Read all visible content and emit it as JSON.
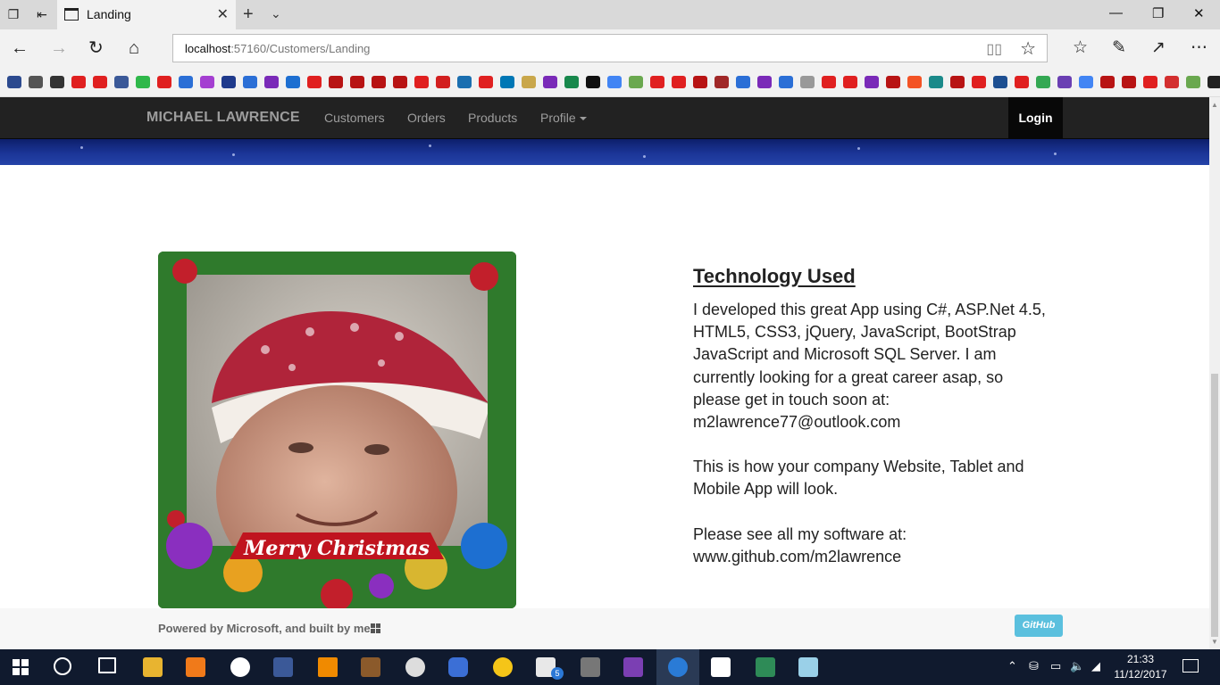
{
  "browser": {
    "tab_title": "Landing",
    "url_host": "localhost",
    "url_path": ":57160/Customers/Landing",
    "close_glyph": "✕",
    "new_tab_glyph": "+",
    "minimize_glyph": "—",
    "maximize_glyph": "❐",
    "window_close_glyph": "✕"
  },
  "navbar": {
    "brand": "MICHAEL LAWRENCE",
    "links": [
      "Customers",
      "Orders",
      "Products",
      "Profile"
    ],
    "login": "Login"
  },
  "content": {
    "heading": "Technology Used",
    "para1_lines": [
      "I developed this great App using C#, ASP.Net 4.5,",
      "HTML5, CSS3, jQuery, JavaScript, BootStrap",
      "JavaScript and Microsoft SQL Server. I am",
      "currently looking for a great career asap, so",
      "please get in touch soon at:",
      "m2lawrence77@outlook.com"
    ],
    "para2_lines": [
      "This is how your company Website, Tablet and",
      "Mobile App will look."
    ],
    "para3_lines": [
      "Please see all my software at:",
      "www.github.com/m2lawrence"
    ],
    "photo_caption": "Merry Christmas"
  },
  "footer": {
    "text": "Powered by Microsoft, and built by me.",
    "github_button": "GitHub"
  },
  "taskbar": {
    "time": "21:33",
    "date": "11/12/2017",
    "mail_badge": "5"
  },
  "colors": {
    "navbar_bg": "#222222",
    "banner": "#1b3597",
    "github_button": "#5bc0de",
    "taskbar": "#101a2e"
  }
}
